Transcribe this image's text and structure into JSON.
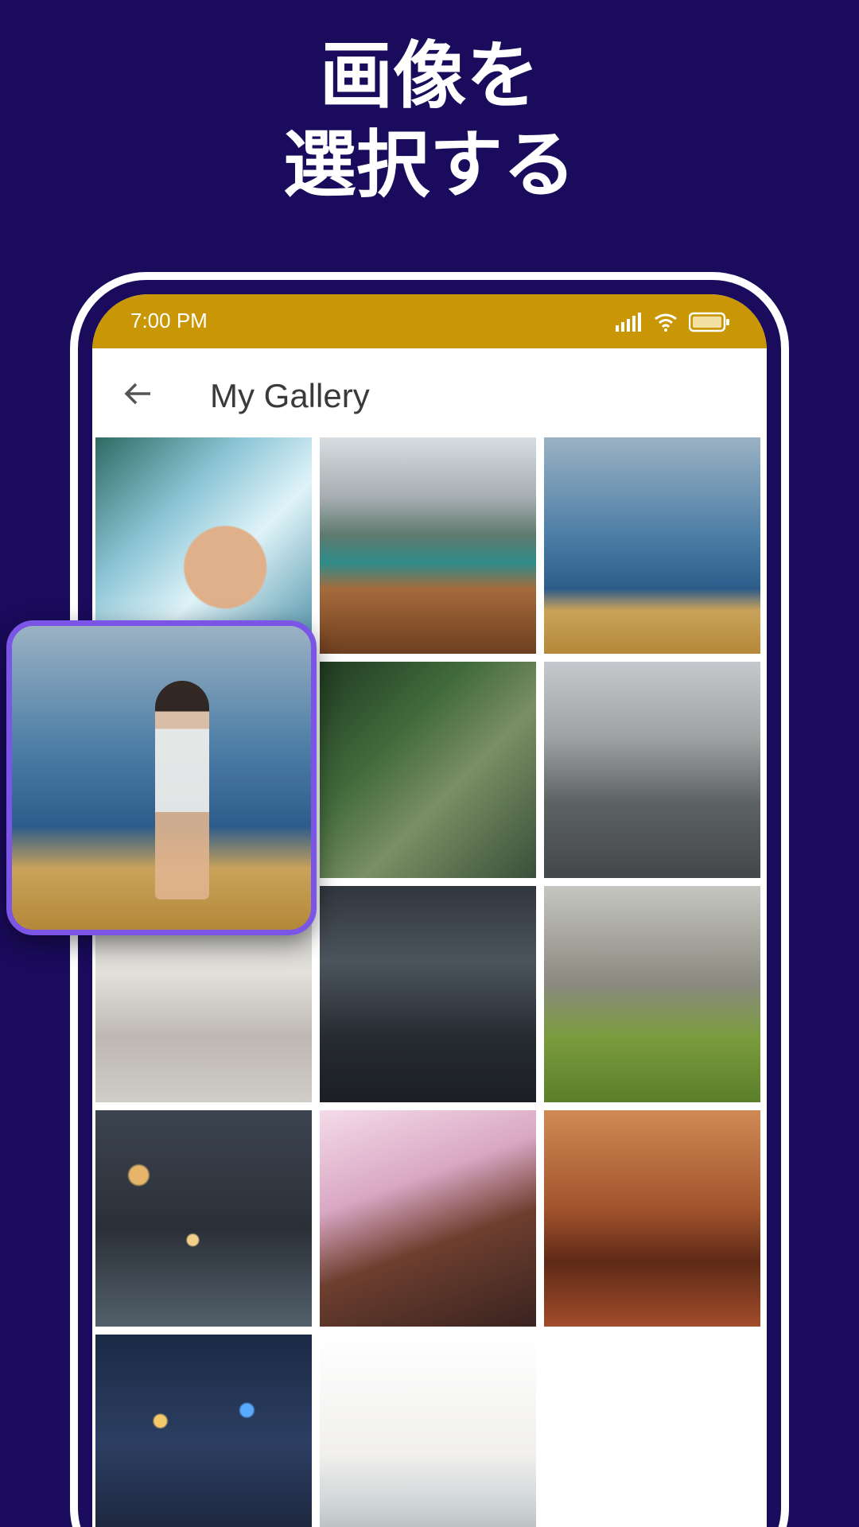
{
  "headline": {
    "line1": "画像を",
    "line2": "選択する"
  },
  "status_bar": {
    "time": "7:00 PM",
    "icons": [
      "signal-icon",
      "wifi-icon",
      "battery-icon"
    ],
    "background_color": "#c99705"
  },
  "app_bar": {
    "title": "My Gallery",
    "back_icon": "arrow-left-icon"
  },
  "gallery": {
    "columns": 3,
    "items": [
      {
        "id": "photo-woman-in-water"
      },
      {
        "id": "photo-boat-mountain-lake"
      },
      {
        "id": "photo-woman-rainbow-field"
      },
      {
        "id": "photo-woman-beach-towel"
      },
      {
        "id": "photo-woman-garden"
      },
      {
        "id": "photo-woman-wading"
      },
      {
        "id": "photo-woman-wall"
      },
      {
        "id": "photo-woman-lying-water"
      },
      {
        "id": "photo-woman-hat-grass"
      },
      {
        "id": "photo-woman-city-lights"
      },
      {
        "id": "photo-woman-sunlight"
      },
      {
        "id": "photo-yoga-sunset"
      },
      {
        "id": "photo-woman-night-lights"
      },
      {
        "id": "photo-woman-beach-hair"
      }
    ],
    "selected_item": "photo-woman-rainbow-field"
  },
  "colors": {
    "background": "#1a0b5c",
    "accent": "#7a55e6",
    "status_bar": "#c99705"
  }
}
